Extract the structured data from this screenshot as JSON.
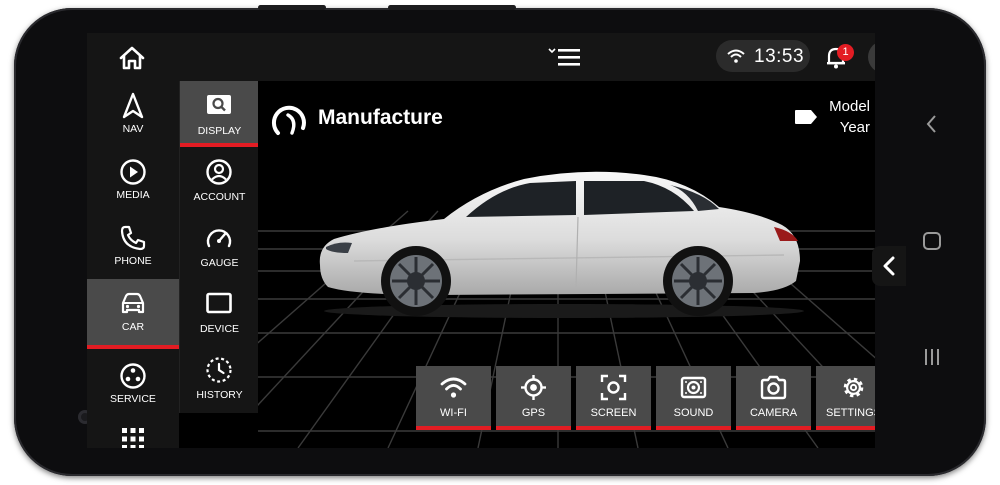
{
  "status": {
    "time": "13:53",
    "notification_count": "1"
  },
  "sidebar": {
    "items": [
      {
        "label": "NAV",
        "icon": "nav-arrow-icon"
      },
      {
        "label": "MEDIA",
        "icon": "play-circle-icon"
      },
      {
        "label": "PHONE",
        "icon": "phone-icon"
      },
      {
        "label": "CAR",
        "icon": "car-icon",
        "active": true
      },
      {
        "label": "SERVICE",
        "icon": "service-icon"
      }
    ]
  },
  "subpanel": {
    "items": [
      {
        "label": "DISPLAY",
        "icon": "display-search-icon",
        "active": true
      },
      {
        "label": "ACCOUNT",
        "icon": "account-icon"
      },
      {
        "label": "GAUGE",
        "icon": "gauge-icon"
      },
      {
        "label": "DEVICE",
        "icon": "device-icon"
      },
      {
        "label": "HISTORY",
        "icon": "history-icon"
      }
    ]
  },
  "main": {
    "brand_title": "Manufacture",
    "model_label": "Model",
    "year_label": "Year"
  },
  "tiles": [
    {
      "label": "WI-FI",
      "icon": "wifi-icon"
    },
    {
      "label": "GPS",
      "icon": "gps-icon"
    },
    {
      "label": "SCREEN",
      "icon": "screen-capture-icon"
    },
    {
      "label": "SOUND",
      "icon": "sound-icon"
    },
    {
      "label": "CAMERA",
      "icon": "camera-icon"
    },
    {
      "label": "SETTINGS",
      "icon": "settings-gear-icon"
    }
  ],
  "colors": {
    "accent": "#e31c23",
    "panel": "#151515",
    "tile": "#4a4a4a",
    "online": "#1fb4e2"
  }
}
